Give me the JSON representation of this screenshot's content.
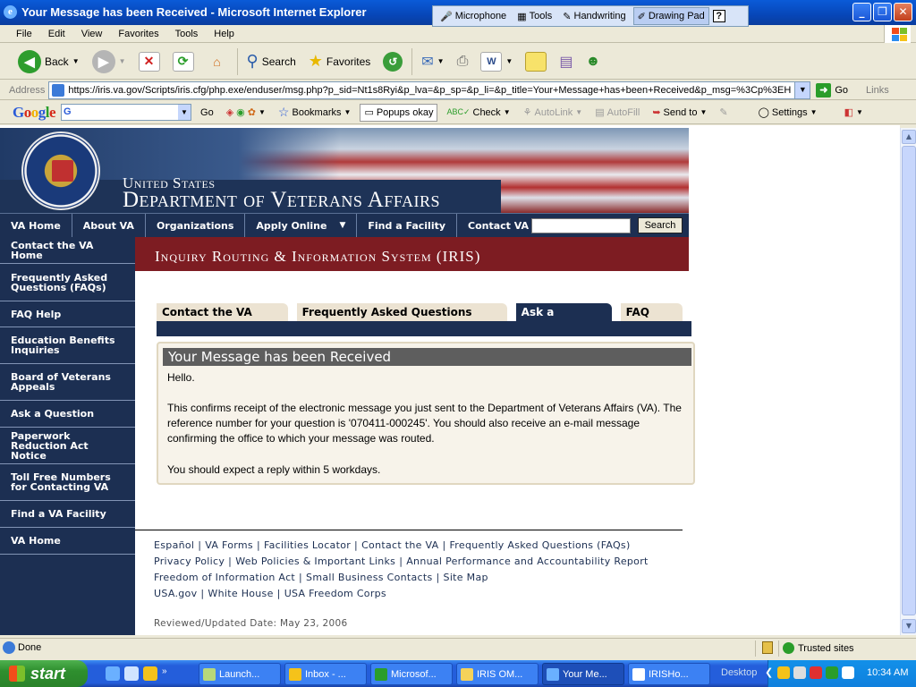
{
  "window": {
    "title": "Your Message has been Received - Microsoft Internet Explorer",
    "buttons": [
      "_",
      "❐",
      "✕"
    ]
  },
  "language_bar": {
    "items": [
      "Microphone",
      "Tools",
      "Handwriting",
      "Drawing Pad"
    ],
    "help": "?"
  },
  "menu": [
    "File",
    "Edit",
    "View",
    "Favorites",
    "Tools",
    "Help"
  ],
  "toolbar": {
    "back": "Back",
    "search": "Search",
    "favorites": "Favorites"
  },
  "address": {
    "label": "Address",
    "url": "https://iris.va.gov/Scripts/iris.cfg/php.exe/enduser/msg.php?p_sid=Nt1s8Ryi&p_lva=&p_sp=&p_li=&p_title=Your+Message+has+been+Received&p_msg=%3Cp%3EH",
    "go": "Go",
    "links": "Links"
  },
  "google_bar": {
    "logo": "Google",
    "go": "Go",
    "bookmarks": "Bookmarks",
    "popups": "Popups okay",
    "check": "Check",
    "autolink": "AutoLink",
    "autofill": "AutoFill",
    "sendto": "Send to",
    "settings": "Settings"
  },
  "banner": {
    "line1": "United States",
    "line2": "Department of Veterans Affairs"
  },
  "topnav": {
    "items": [
      "VA Home",
      "About VA",
      "Organizations",
      "Apply Online",
      "Find a Facility",
      "Contact VA"
    ],
    "search_button": "Search"
  },
  "sidebar": {
    "items": [
      "Contact the VA Home",
      "Frequently Asked Questions (FAQs)",
      "FAQ Help",
      "Education Benefits Inquiries",
      "Board of Veterans Appeals",
      "Ask a Question",
      "Paperwork Reduction Act Notice",
      "Toll Free Numbers for Contacting VA",
      "Find a VA Facility",
      "VA Home"
    ]
  },
  "iris_title": "Inquiry Routing & Information System (IRIS)",
  "tabs": [
    "Contact the VA Home",
    "Frequently Asked Questions (FAQs)",
    "Ask a Question",
    "FAQ Help"
  ],
  "message": {
    "heading": "Your Message has been Received",
    "greeting": "Hello.",
    "body": "This confirms receipt of the electronic message you just sent to the Department of Veterans Affairs (VA).  The reference number for your question is '070411-000245'.   You should also receive an e-mail message confirming the office to which your message was routed.",
    "reply": "You should expect a reply within 5 workdays."
  },
  "footer": {
    "row1": [
      "Español",
      "VA Forms",
      "Facilities Locator",
      "Contact the VA",
      "Frequently Asked Questions (FAQs)"
    ],
    "row2": [
      "Privacy Policy",
      "Web Policies & Important Links",
      "Annual Performance and Accountability Report"
    ],
    "row3": [
      "Freedom of Information Act",
      "Small Business Contacts",
      "Site Map"
    ],
    "row4": [
      "USA.gov",
      "White House",
      "USA Freedom Corps"
    ],
    "separator": "|",
    "reviewed": "Reviewed/Updated Date: May 23, 2006"
  },
  "status": {
    "text": "Done",
    "zone": "Trusted sites"
  },
  "taskbar": {
    "start": "start",
    "tasks": [
      "Launch...",
      "Inbox - ...",
      "Microsof...",
      "IRIS OM...",
      "Your Me...",
      "IRISHo..."
    ],
    "desktop": "Desktop",
    "clock": "10:34 AM"
  }
}
